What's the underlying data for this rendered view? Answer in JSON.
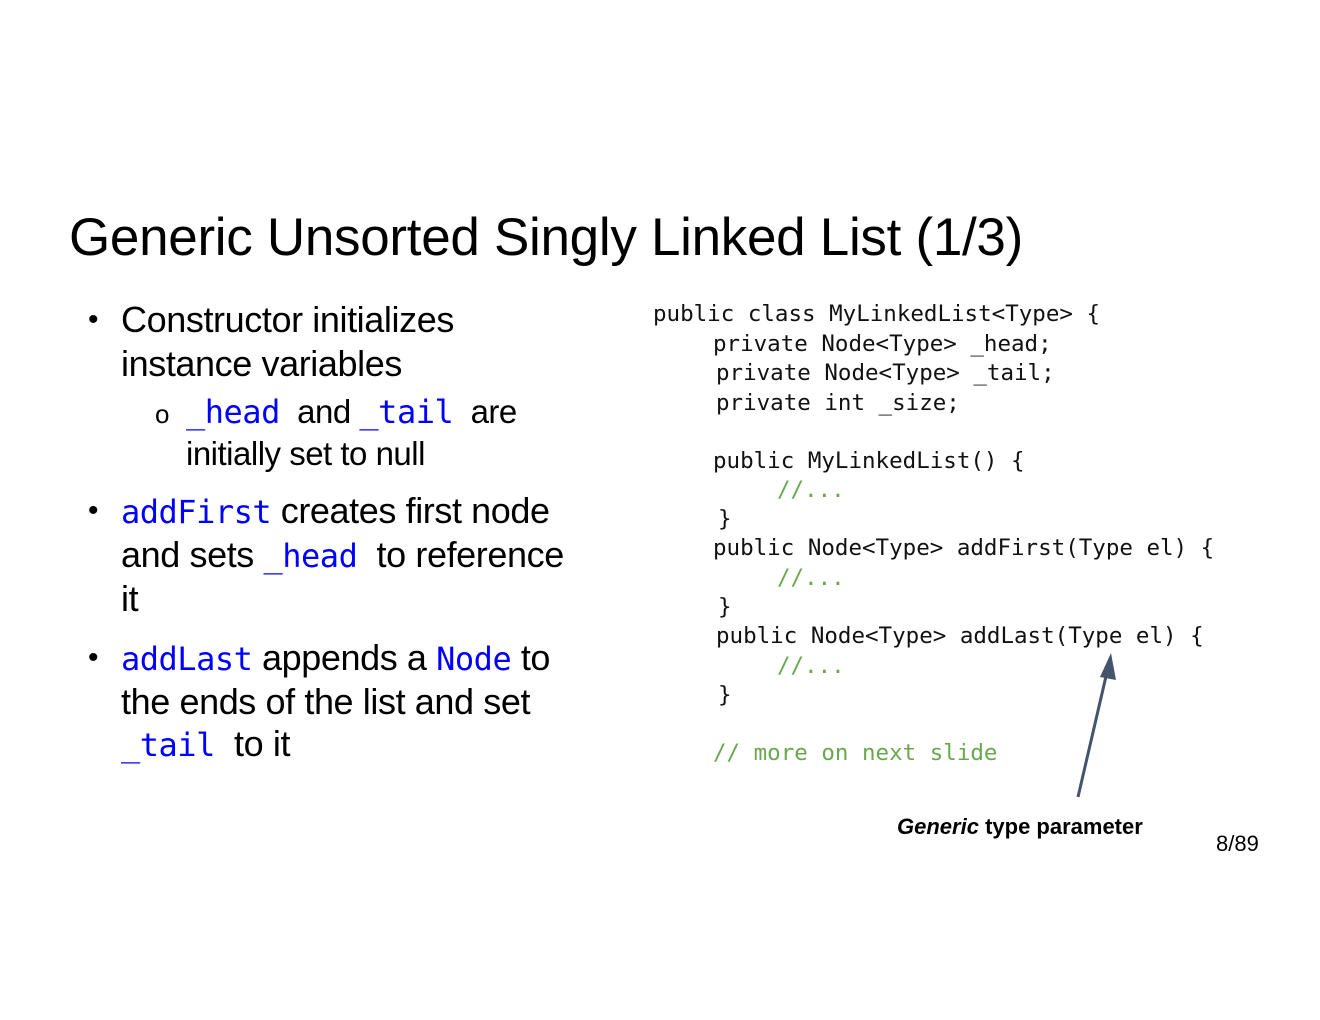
{
  "slide": {
    "title": "Generic Unsorted Singly Linked List (1/3)",
    "page_number": "8/89",
    "accent_code_color": "#0000ff",
    "comment_color": "#6aa84f",
    "arrow_color": "#44546a"
  },
  "bullets": {
    "b1": {
      "line1": "Constructor initializes",
      "line2": "instance variables",
      "sub": {
        "marker": "o",
        "code_head": "_head",
        "and": "and",
        "code_tail": "_tail",
        "are": "are",
        "line2": "initially set to null"
      }
    },
    "b2": {
      "code": "addFirst",
      "line1_rest": "creates first node",
      "line2_pre": "and sets",
      "code_head": "_head",
      "line2_post": "to reference",
      "line3": "it"
    },
    "b3": {
      "code": "addLast",
      "line1_mid": "appends a",
      "code_node": "Node",
      "line1_post": "to",
      "line2": "the ends of the list and set",
      "code_tail": "_tail",
      "line3_post": "to it"
    }
  },
  "code": {
    "l1": "public class MyLinkedList<Type> {",
    "l2": "private Node<Type> _head;",
    "l3": "private Node<Type> _tail;",
    "l4": "private int _size;",
    "l5": "public MyLinkedList() {",
    "c1": "//...",
    "l6": "}",
    "l7": "public Node<Type> addFirst(Type el) {",
    "c2": "//...",
    "l8": "}",
    "l9": "public Node<Type> addLast(Type el) {",
    "c3": "//...",
    "l10": "}",
    "c4": "// more on next slide"
  },
  "annotation": {
    "italic": "Generic",
    "rest": "type parameter"
  }
}
